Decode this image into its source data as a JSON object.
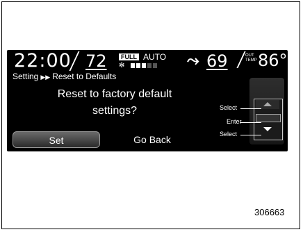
{
  "status_bar": {
    "time": "22:00",
    "driver_temp": "72",
    "fan_mode_badge": "FULL",
    "climate_mode": "AUTO",
    "fan_icon": "fan-icon",
    "airflow_icon": "airflow-icon",
    "passenger_temp": "69",
    "outside_temp_label_line1": "OUT",
    "outside_temp_label_line2": "TEMP",
    "outside_temp": "86°F",
    "fan_level": 0.4
  },
  "breadcrumb": {
    "parent": "Setting",
    "separator": "▶▶",
    "current": "Reset to Defaults"
  },
  "dialog": {
    "question_line1": "Reset to factory default",
    "question_line2": "settings?",
    "set_label": "Set",
    "back_label": "Go Back"
  },
  "control_dial": {
    "select_up_label": "Select",
    "enter_label": "Enter",
    "select_down_label": "Select"
  },
  "figure_id": "306663"
}
